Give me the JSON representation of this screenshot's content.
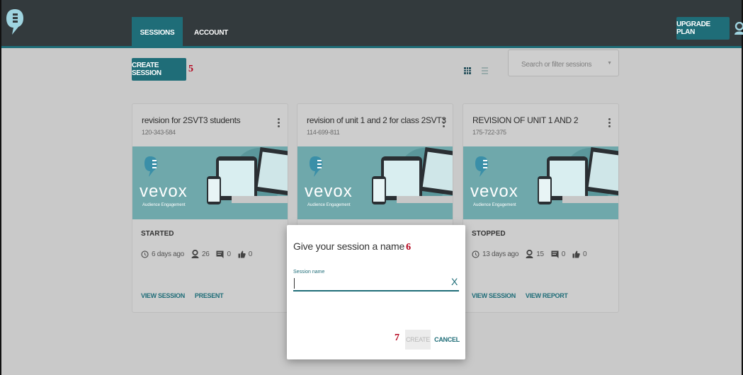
{
  "nav": {
    "tabs": [
      {
        "label": "SESSIONS",
        "active": true
      },
      {
        "label": "ACCOUNT",
        "active": false
      }
    ],
    "upgrade_label": "UPGRADE PLAN"
  },
  "toolbar": {
    "create_label": "CREATE SESSION",
    "search_placeholder": "Search or filter sessions"
  },
  "markers": {
    "create": "5",
    "dialog": "6",
    "confirm": "7"
  },
  "cards": [
    {
      "title": "revision for 2SVT3 students",
      "code": "120-343-584",
      "brand": "vevox",
      "tagline": "Audience Engagement",
      "status": "STARTED",
      "age": "6 days ago",
      "participants": "26",
      "questions": "0",
      "likes": "0",
      "actions": [
        "VIEW SESSION",
        "PRESENT"
      ]
    },
    {
      "title": "revision of unit 1 and 2 for class 2SVT3",
      "code": "114-699-811",
      "brand": "vevox",
      "tagline": "Audience Engagement"
    },
    {
      "title": "REVISION OF UNIT 1 AND 2",
      "code": "175-722-375",
      "brand": "vevox",
      "tagline": "Audience Engagement",
      "status": "STOPPED",
      "age": "13 days ago",
      "participants": "15",
      "questions": "0",
      "likes": "0",
      "actions": [
        "VIEW SESSION",
        "VIEW REPORT"
      ]
    }
  ],
  "dialog": {
    "title": "Give your session a name",
    "field_label": "Session name",
    "field_value": "",
    "clear_label": "X",
    "create_label": "CREATE",
    "cancel_label": "CANCEL"
  },
  "colors": {
    "accent": "#1f6d78",
    "header": "#333a3d",
    "marker": "#b4001a"
  }
}
